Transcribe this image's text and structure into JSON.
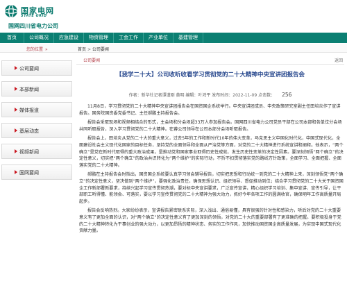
{
  "header": {
    "logo_cn": "国家电网",
    "logo_en": "STATE GRID",
    "site_name": "国网四川省电力公司"
  },
  "nav": {
    "items": [
      "首页",
      "公司概况",
      "应急建设",
      "物资管理",
      "工会工作",
      "产业单位",
      "基建管理"
    ]
  },
  "breadcrumb": {
    "location_label": "您的位置",
    "home": "首页",
    "separator": ">",
    "current": "公司要闻"
  },
  "sidebar": {
    "items": [
      "公司要闻",
      "本部新闻",
      "媒体报道",
      "基层动态",
      "视频新闻",
      "国网要闻"
    ]
  },
  "content": {
    "section_label": "公司要闻",
    "more_label": "返回",
    "title": "【我学二十大】公司收听收看学习贯彻党的二十大精神中央宣讲团报告会",
    "meta": "作者：新华社记者谭谨刚  黄明  编辑：叶鸿平  发布时间：2022-11-09  点击数：",
    "views": "256",
    "paragraphs": [
      "11月8日，学习贯彻党的二十大精神中央宣讲团报告会在国资国企系统举行。中央宣讲团成员、中央政策研究室副主任田培炎作了宣讲报告。国务院国资委党委书记、主任郝鹏主持报告会。",
      "报告会采取现场和视频相结合的形式，主会场和分会场超33万人参加报告会。国网四川省电力公司党员干部在公司本部和各单位分会场共同听取报告，深入学习贯彻党的二十大精神。在蓉公司领导在公司本部分会场听取报告。",
      "报告会上，田培炎从党的二十大的重大意义，过去5年的工作和新时代10年的伟大变革，马克思主义中国化时代化，中国式现代化，全面建设社会主义现代化国家的目标任务，坚持党的全面领导和全面从严治党等方面，对党的二十大精神进行系统宣讲和阐释。他表示，“两个确立”是党在新时代取得的重大政治成果，是推动党和国家事业取得历史性成就、发生历史性变革的决定性因素。要深刻领悟“两个确立”的决定性意义，切实把“两个确立”的政治共识转化为“两个维护”的实际行动，不折不扣贯彻落实党的路线方针政策，全面学习、全面把握、全面落实党的二十大精神。",
      "郝鹏在主持报告会时指出，国资国企系统要认真学习领会辅导报告，切实把思想和行动统一到党的二十大精神上来，深刻领悟党“两个确立”的决定性意义，坚决做到“两个维护”，要强化政治责任，确保思想认识、组织领导、督促推动到位；结合学习贯彻党的二十大关于国资国企工作新部署新要求，持续兴起学习宣传贯彻热潮，要对标中央宣讲要求，广泛宣传宣讲，精心组织学习培训、集中宣讲、宣传引导，让干部职工听得懂、能领会、可落实，要以学习宣传贯彻党的二十大精神为强大动力，抓好今年各项工作的圆满收官，确保明年工作高质量开局起步。",
      "报告会反响热烈。大家纷纷表示，宣讲报告紧密联系实际，深入浅出、通俗易懂，具有很强的针对性和感染力，听后对党的二十大重要意义有了更加全面的认识，对“两个确立”的决定性意义有了更加深刻的领悟，对党的二十大的重要部署有了更准确的把握。要积极投身于党的二十大精神转化为干事创业的强大动力，以更加昂扬的精神状态、务实的工作作风，加快推动国资国企高质量发展，为实现中国式现代化贡献力量。"
    ]
  },
  "colors": {
    "brand": "#0b7f72",
    "accent": "#c9151e",
    "title": "#2a4a8f"
  }
}
